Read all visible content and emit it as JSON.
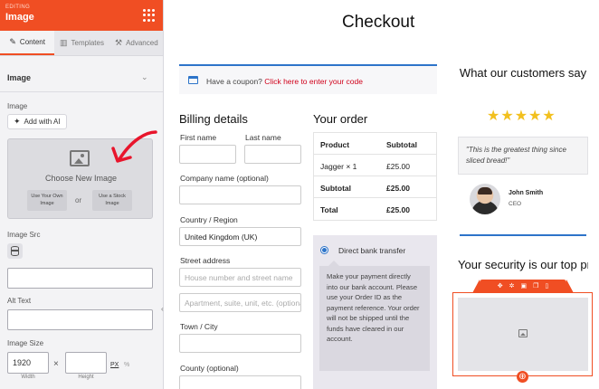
{
  "sidebar": {
    "editing_label": "EDITING",
    "title": "Image",
    "tabs": [
      {
        "label": "Content",
        "icon": "pencil-icon"
      },
      {
        "label": "Templates",
        "icon": "template-icon"
      },
      {
        "label": "Advanced",
        "icon": "wrench-icon"
      }
    ],
    "section_title": "Image",
    "image_label": "Image",
    "add_ai_label": "Add with AI",
    "choose_new_image": "Choose New Image",
    "use_own_image": "Use Your Own Image",
    "or_label": "or",
    "use_stock_image": "Use a Stock Image",
    "image_src_label": "Image Src",
    "image_src_value": "",
    "alt_text_label": "Alt Text",
    "alt_text_value": "",
    "image_size_label": "Image Size",
    "width_value": "1920",
    "height_value": "",
    "width_label": "Width",
    "height_label": "Height",
    "unit_px": "PX",
    "unit_pct": "%",
    "accent_color": "#f04e23"
  },
  "main": {
    "page_title": "Checkout",
    "coupon": {
      "text": "Have a coupon?",
      "link": "Click here to enter your code"
    },
    "billing": {
      "heading": "Billing details",
      "first_name_label": "First name",
      "last_name_label": "Last name",
      "company_label": "Company name (optional)",
      "country_label": "Country / Region",
      "country_value": "United Kingdom (UK)",
      "street_label": "Street address",
      "street_placeholder": "House number and street name",
      "apartment_placeholder": "Apartment, suite, unit, etc. (optional)",
      "town_label": "Town / City",
      "county_label": "County (optional)"
    },
    "order": {
      "heading": "Your order",
      "columns": [
        "Product",
        "Subtotal"
      ],
      "rows": [
        {
          "product": "Jagger  × 1",
          "subtotal": "£25.00"
        },
        {
          "product": "Subtotal",
          "subtotal": "£25.00"
        },
        {
          "product": "Total",
          "subtotal": "£25.00"
        }
      ],
      "payment_method": "Direct bank transfer",
      "payment_description": "Make your payment directly into our bank account. Please use your Order ID as the payment reference. Your order will not be shipped until the funds have cleared in our account."
    }
  },
  "right": {
    "testimonial_title": "What our customers say",
    "stars": "★★★★★",
    "rating": 5,
    "quote": "\"This is the greatest thing since sliced bread!\"",
    "person_name": "John Smith",
    "person_role": "CEO",
    "security_title": "Your security is our top priority"
  }
}
